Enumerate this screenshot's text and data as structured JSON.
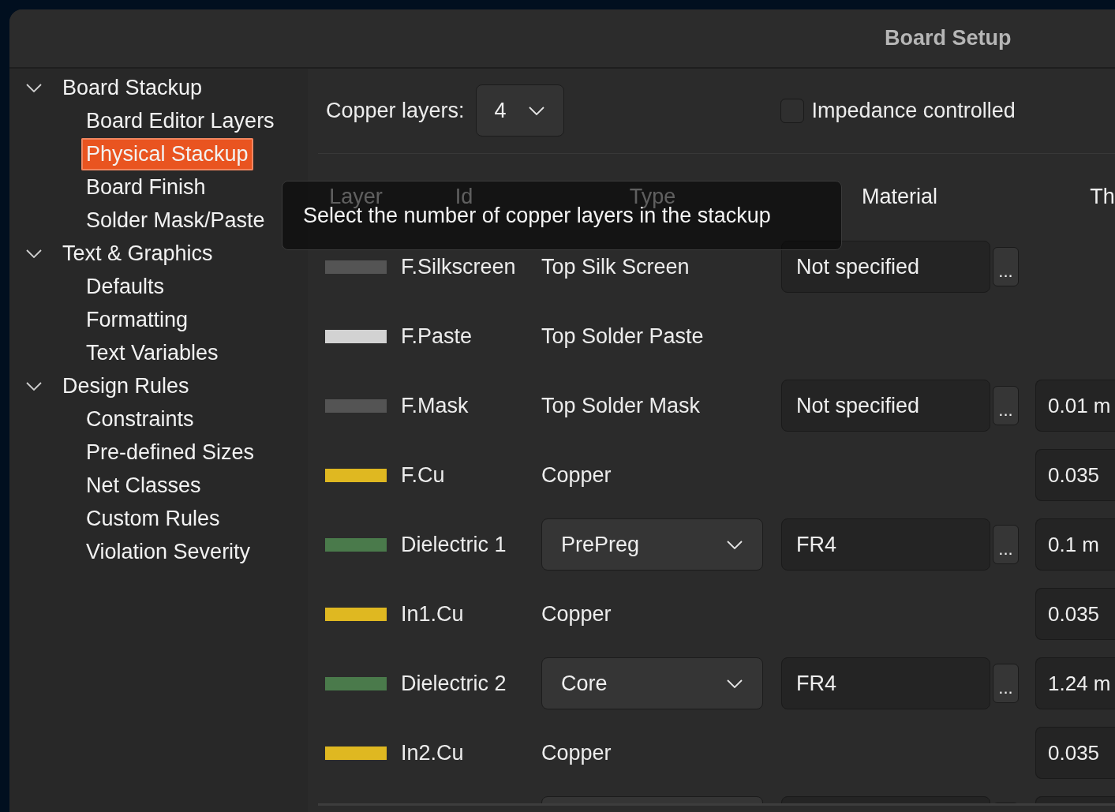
{
  "window": {
    "title": "Board Setup"
  },
  "sidebar": {
    "items": [
      {
        "label": "Board Stackup",
        "expanded": true,
        "selected": false,
        "children": [
          {
            "label": "Board Editor Layers",
            "selected": false
          },
          {
            "label": "Physical Stackup",
            "selected": true
          },
          {
            "label": "Board Finish",
            "selected": false
          },
          {
            "label": "Solder Mask/Paste",
            "selected": false
          }
        ]
      },
      {
        "label": "Text & Graphics",
        "expanded": true,
        "selected": false,
        "children": [
          {
            "label": "Defaults",
            "selected": false
          },
          {
            "label": "Formatting",
            "selected": false
          },
          {
            "label": "Text Variables",
            "selected": false
          }
        ]
      },
      {
        "label": "Design Rules",
        "expanded": true,
        "selected": false,
        "children": [
          {
            "label": "Constraints",
            "selected": false
          },
          {
            "label": "Pre-defined Sizes",
            "selected": false
          },
          {
            "label": "Net Classes",
            "selected": false
          },
          {
            "label": "Custom Rules",
            "selected": false
          },
          {
            "label": "Violation Severity",
            "selected": false
          }
        ]
      }
    ]
  },
  "copper_layers": {
    "label": "Copper layers:",
    "value": "4"
  },
  "impedance": {
    "label": "Impedance controlled",
    "checked": false
  },
  "stackup": {
    "columns": [
      "Layer",
      "Id",
      "Type",
      "Material",
      "Th"
    ],
    "rows": [
      {
        "kind": "layer",
        "color": "#545454",
        "id": "F.Silkscreen",
        "type": "Top Silk Screen",
        "material": "Not specified",
        "material_button": "..."
      },
      {
        "kind": "layer",
        "color": "#d2d2d2",
        "id": "F.Paste",
        "type": "Top Solder Paste"
      },
      {
        "kind": "layer",
        "color": "#545454",
        "id": "F.Mask",
        "type": "Top Solder Mask",
        "material": "Not specified",
        "material_button": "...",
        "thickness": "0.01 m"
      },
      {
        "kind": "layer",
        "color": "#dfb821",
        "id": "F.Cu",
        "type": "Copper",
        "thickness": "0.035"
      },
      {
        "kind": "dielectric",
        "color": "#4a7a4b",
        "id": "Dielectric 1",
        "type": "PrePreg",
        "material": "FR4",
        "material_button": "...",
        "thickness": "0.1 m"
      },
      {
        "kind": "layer",
        "color": "#dfb821",
        "id": "In1.Cu",
        "type": "Copper",
        "thickness": "0.035"
      },
      {
        "kind": "dielectric",
        "color": "#4a7a4b",
        "id": "Dielectric 2",
        "type": "Core",
        "material": "FR4",
        "material_button": "...",
        "thickness": "1.24 m"
      },
      {
        "kind": "layer",
        "color": "#dfb821",
        "id": "In2.Cu",
        "type": "Copper",
        "thickness": "0.035"
      },
      {
        "kind": "dielectric"
      }
    ]
  },
  "tooltip": {
    "text": "Select the number of copper layers in the stackup"
  }
}
